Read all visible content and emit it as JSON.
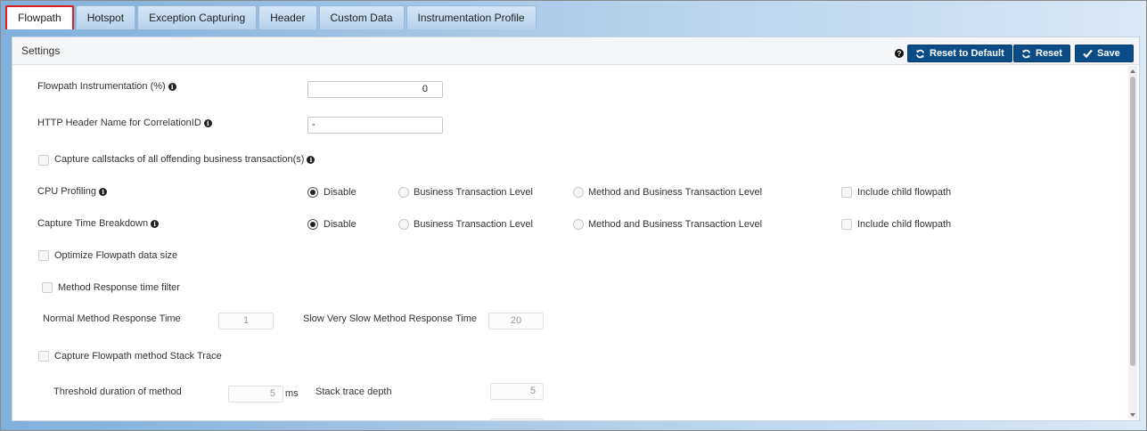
{
  "tabs": [
    {
      "label": "Flowpath",
      "active": true
    },
    {
      "label": "Hotspot"
    },
    {
      "label": "Exception Capturing"
    },
    {
      "label": "Header"
    },
    {
      "label": "Custom Data"
    },
    {
      "label": "Instrumentation Profile"
    }
  ],
  "panel": {
    "title": "Settings",
    "buttons": {
      "reset_default": "Reset to Default",
      "reset": "Reset",
      "save": "Save"
    }
  },
  "form": {
    "flowpath_instr": {
      "label": "Flowpath Instrumentation (%)",
      "value": "0"
    },
    "http_header": {
      "label": "HTTP Header Name for CorrelationID",
      "value": "-"
    },
    "capture_callstacks": {
      "label": "Capture callstacks of all offending business transaction(s)",
      "checked": false
    },
    "cpu_profiling": {
      "label": "CPU Profiling",
      "options": [
        "Disable",
        "Business Transaction Level",
        "Method and Business Transaction Level"
      ],
      "selected": "Disable",
      "include_child": "Include child flowpath"
    },
    "capture_time": {
      "label": "Capture Time Breakdown",
      "options": [
        "Disable",
        "Business Transaction Level",
        "Method and Business Transaction Level"
      ],
      "selected": "Disable",
      "include_child": "Include child flowpath"
    },
    "optimize_size": {
      "label": "Optimize Flowpath data size",
      "checked": false
    },
    "method_resp_filter": {
      "label": "Method Response time filter",
      "checked": false
    },
    "normal_method": {
      "label": "Normal Method Response Time",
      "value": "1"
    },
    "slow_method": {
      "label": "Slow Very Slow Method Response Time",
      "value": "20"
    },
    "capture_stack": {
      "label": "Capture Flowpath method Stack Trace",
      "checked": false
    },
    "threshold": {
      "label": "Threshold duration of method",
      "value": "5",
      "unit": "ms"
    },
    "stack_depth": {
      "label": "Stack trace depth",
      "value": "5"
    }
  },
  "icons": {
    "help": "question-circle-icon",
    "refresh": "refresh-icon",
    "check": "check-icon",
    "info": "info-circle-icon"
  },
  "colors": {
    "button_bg": "#0c4c86",
    "active_tab_border": "#e02020"
  }
}
